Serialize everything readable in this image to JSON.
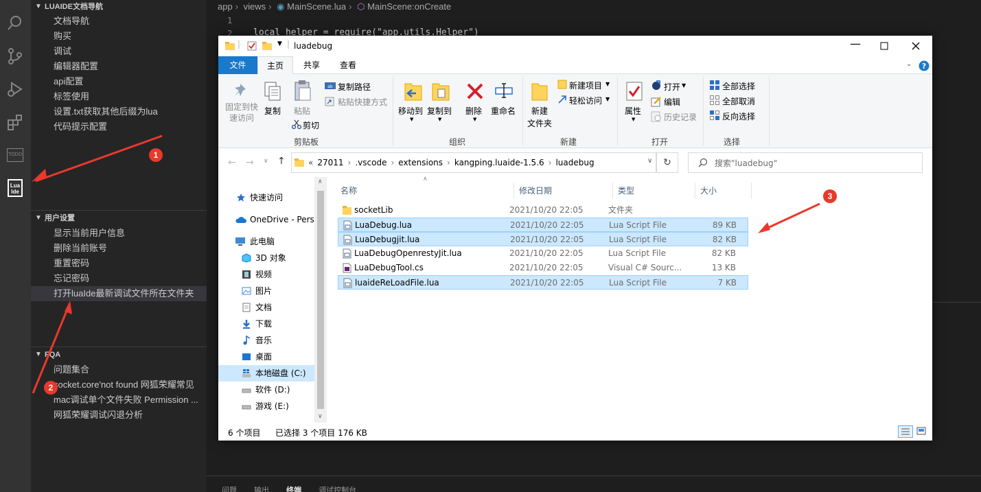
{
  "sidebar": {
    "section1": {
      "title": "LUAIDE文档导航",
      "items": [
        "文档导航",
        "购买",
        "调试",
        "编辑器配置",
        "api配置",
        "标签使用",
        "设置.txt获取其他后缀为lua",
        "代码提示配置"
      ]
    },
    "section2": {
      "title": "用户设置",
      "items": [
        "显示当前用户信息",
        "删除当前账号",
        "重置密码",
        "忘记密码",
        "打开luaIde最新调试文件所在文件夹"
      ]
    },
    "section3": {
      "title": "FQA",
      "items": [
        "问题集合",
        "socket.core'not found 网狐荣耀常见",
        "mac调试单个文件失败 Permission ...",
        "网狐荣耀调试闪退分析"
      ]
    }
  },
  "activity": {
    "todo_label": "TODO",
    "luaide_label": "Lua\nIde"
  },
  "editor": {
    "breadcrumb": [
      "app",
      "views",
      "MainScene.lua",
      "MainScene:onCreate"
    ],
    "line_numbers": [
      "1",
      "2"
    ],
    "code_line2": "local helper = require(\"app.utils.Helper\")",
    "panel_tabs": [
      "问题",
      "输出",
      "终端",
      "调试控制台"
    ]
  },
  "explorer": {
    "title": "luadebug",
    "ribbon_tabs": [
      "文件",
      "主页",
      "共享",
      "查看"
    ],
    "clipboard": {
      "pin": "固定到快\n速访问",
      "copy": "复制",
      "paste": "粘贴",
      "copy_path": "复制路径",
      "paste_shortcut": "粘贴快捷方式",
      "cut": "剪切",
      "label": "剪贴板"
    },
    "organize": {
      "move_to": "移动到",
      "copy_to": "复制到",
      "delete": "删除",
      "rename": "重命名",
      "label": "组织"
    },
    "new": {
      "new_folder": "新建\n文件夹",
      "new_item": "新建项目",
      "easy_access": "轻松访问",
      "label": "新建"
    },
    "open": {
      "properties": "属性",
      "open": "打开",
      "edit": "编辑",
      "history": "历史记录",
      "label": "打开"
    },
    "select": {
      "select_all": "全部选择",
      "select_none": "全部取消",
      "invert": "反向选择",
      "label": "选择"
    },
    "address": {
      "overflow": "«",
      "parts": [
        "27011",
        ".vscode",
        "extensions",
        "kangping.luaide-1.5.6",
        "luadebug"
      ]
    },
    "search_placeholder": "搜索\"luadebug\"",
    "nav": [
      "快速访问",
      "OneDrive - Perso",
      "此电脑",
      "3D 对象",
      "视频",
      "图片",
      "文档",
      "下载",
      "音乐",
      "桌面",
      "本地磁盘 (C:)",
      "软件 (D:)",
      "游戏 (E:)"
    ],
    "columns": [
      "名称",
      "修改日期",
      "类型",
      "大小"
    ],
    "files": [
      {
        "name": "socketLib",
        "date": "2021/10/20 22:05",
        "type": "文件夹",
        "size": "",
        "selected": false,
        "kind": "folder"
      },
      {
        "name": "LuaDebug.lua",
        "date": "2021/10/20 22:05",
        "type": "Lua Script File",
        "size": "89 KB",
        "selected": true,
        "kind": "file"
      },
      {
        "name": "LuaDebugjit.lua",
        "date": "2021/10/20 22:05",
        "type": "Lua Script File",
        "size": "82 KB",
        "selected": true,
        "kind": "file"
      },
      {
        "name": "LuaDebugOpenrestyJit.lua",
        "date": "2021/10/20 22:05",
        "type": "Lua Script File",
        "size": "82 KB",
        "selected": false,
        "kind": "file"
      },
      {
        "name": "LuaDebugTool.cs",
        "date": "2021/10/20 22:05",
        "type": "Visual C# Sourc...",
        "size": "13 KB",
        "selected": false,
        "kind": "cs"
      },
      {
        "name": "luaideReLoadFile.lua",
        "date": "2021/10/20 22:05",
        "type": "Lua Script File",
        "size": "7 KB",
        "selected": true,
        "kind": "file"
      }
    ],
    "status": {
      "count": "6 个项目",
      "selection": "已选择 3 个项目  176 KB"
    }
  },
  "annotations": [
    "1",
    "2",
    "3"
  ],
  "colors": {
    "annot_red": "#e8392b",
    "ribbon_blue": "#1979ca",
    "selection": "#cce8ff"
  }
}
